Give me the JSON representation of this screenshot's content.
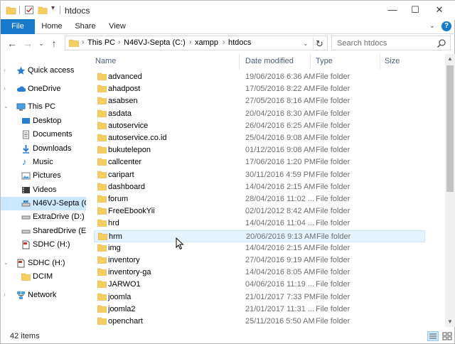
{
  "window": {
    "title": "htdocs",
    "controls": {
      "minimize": "—",
      "maximize": "☐",
      "close": "✕"
    }
  },
  "ribbon": {
    "tabs": [
      {
        "label": "File",
        "active": true
      },
      {
        "label": "Home"
      },
      {
        "label": "Share"
      },
      {
        "label": "View"
      }
    ],
    "help": "?"
  },
  "address": {
    "crumbs": [
      "This PC",
      "N46VJ-Septa (C:)",
      "xampp",
      "htdocs"
    ],
    "search_placeholder": "Search htdocs"
  },
  "nav": {
    "items": [
      {
        "label": "Quick access",
        "icon": "star-icon"
      },
      {
        "label": "OneDrive",
        "icon": "cloud-icon"
      },
      {
        "label": "This PC",
        "icon": "computer-icon"
      },
      {
        "label": "Desktop",
        "icon": "desktop-icon"
      },
      {
        "label": "Documents",
        "icon": "documents-icon"
      },
      {
        "label": "Downloads",
        "icon": "download-icon"
      },
      {
        "label": "Music",
        "icon": "music-icon"
      },
      {
        "label": "Pictures",
        "icon": "pictures-icon"
      },
      {
        "label": "Videos",
        "icon": "videos-icon"
      },
      {
        "label": "N46VJ-Septa (C:)",
        "icon": "drive-icon",
        "selected": true
      },
      {
        "label": "ExtraDrive (D:)",
        "icon": "drive-icon"
      },
      {
        "label": "SharedDrive (E:)",
        "icon": "drive-icon"
      },
      {
        "label": "SDHC (H:)",
        "icon": "sd-card-icon"
      },
      {
        "label": "SDHC (H:)",
        "icon": "sd-card-icon"
      },
      {
        "label": "DCIM",
        "icon": "folder-icon"
      },
      {
        "label": "Network",
        "icon": "network-icon"
      }
    ]
  },
  "columns": {
    "name": "Name",
    "date": "Date modified",
    "type": "Type",
    "size": "Size"
  },
  "files": [
    {
      "name": "advanced",
      "date": "19/06/2016 6:36 AM",
      "type": "File folder"
    },
    {
      "name": "ahadpost",
      "date": "17/05/2016 8:22 AM",
      "type": "File folder"
    },
    {
      "name": "asabsen",
      "date": "27/05/2016 8:16 AM",
      "type": "File folder"
    },
    {
      "name": "asdata",
      "date": "20/04/2016 8:30 AM",
      "type": "File folder"
    },
    {
      "name": "autoservice",
      "date": "26/04/2016 6:25 AM",
      "type": "File folder"
    },
    {
      "name": "autoservice.co.id",
      "date": "25/04/2016 9:08 AM",
      "type": "File folder"
    },
    {
      "name": "bukutelepon",
      "date": "01/12/2016 9:08 AM",
      "type": "File folder"
    },
    {
      "name": "callcenter",
      "date": "17/06/2016 1:20 PM",
      "type": "File folder"
    },
    {
      "name": "caripart",
      "date": "30/11/2016 4:59 PM",
      "type": "File folder"
    },
    {
      "name": "dashboard",
      "date": "14/04/2016 2:15 AM",
      "type": "File folder"
    },
    {
      "name": "forum",
      "date": "28/04/2016 11:02 ...",
      "type": "File folder"
    },
    {
      "name": "FreeEbookYii",
      "date": "02/01/2012 8:42 AM",
      "type": "File folder"
    },
    {
      "name": "hrd",
      "date": "14/04/2016 11:04 ...",
      "type": "File folder"
    },
    {
      "name": "hrm",
      "date": "20/06/2016 9:13 AM",
      "type": "File folder",
      "hover": true
    },
    {
      "name": "img",
      "date": "14/04/2016 2:15 AM",
      "type": "File folder"
    },
    {
      "name": "inventory",
      "date": "27/04/2016 9:19 AM",
      "type": "File folder"
    },
    {
      "name": "inventory-ga",
      "date": "14/04/2016 8:05 AM",
      "type": "File folder"
    },
    {
      "name": "JARWO1",
      "date": "04/06/2016 11:19 ...",
      "type": "File folder"
    },
    {
      "name": "joomla",
      "date": "21/01/2017 7:33 PM",
      "type": "File folder"
    },
    {
      "name": "joomla2",
      "date": "21/01/2017 11:31 ...",
      "type": "File folder"
    },
    {
      "name": "openchart",
      "date": "25/11/2016 5:50 AM",
      "type": "File folder"
    }
  ],
  "status": {
    "count": "42 items"
  },
  "colors": {
    "accent": "#1979ca",
    "folder": "#f6cd5f",
    "selected": "#cce8ff",
    "hover": "#e5f3ff"
  }
}
